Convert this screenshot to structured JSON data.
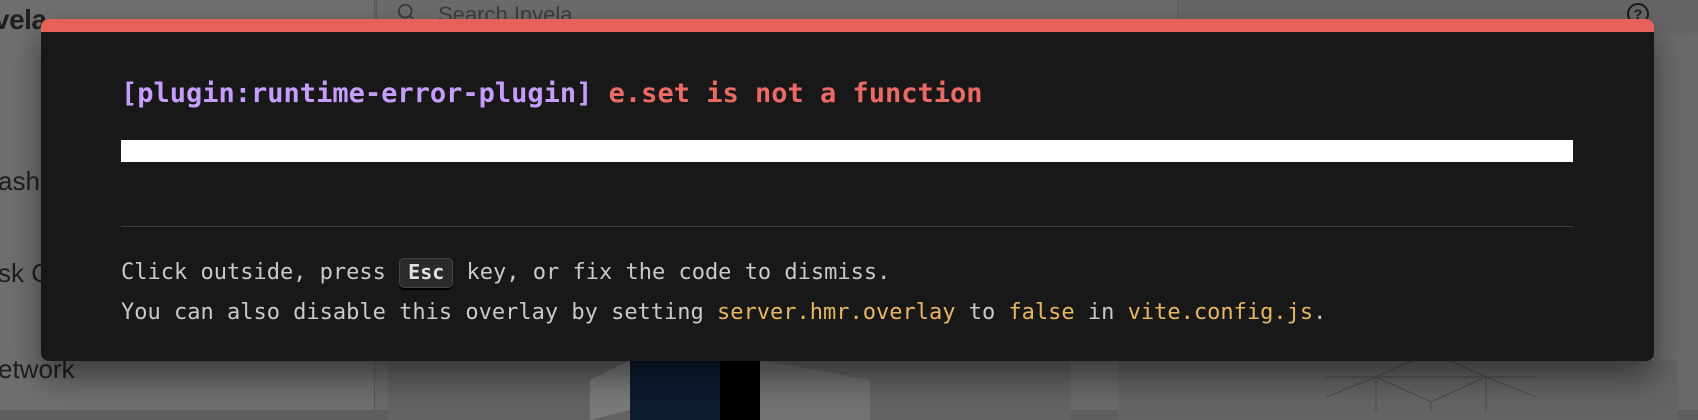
{
  "app": {
    "logo_text": "vela",
    "search_placeholder": "Search Invela",
    "nav_items": [
      {
        "label": "ashb"
      },
      {
        "label": "sk C"
      },
      {
        "label": "etwork"
      }
    ]
  },
  "overlay": {
    "plugin_tag": "[plugin:runtime-error-plugin]",
    "message": "e.set is not a function",
    "tip_line1": {
      "before": "Click outside, press ",
      "key": "Esc",
      "after": " key, or fix the code to dismiss."
    },
    "tip_line2": {
      "part1": "You can also disable this overlay by setting ",
      "code1": "server.hmr.overlay",
      "part2": " to ",
      "code2": "false",
      "part3": " in ",
      "code3": "vite.config.js",
      "part4": "."
    },
    "colors": {
      "accent_bar": "#e8605a",
      "plugin_tag": "#c79dfb",
      "message": "#ec6a65",
      "code_highlight": "#e8b65f",
      "background": "#181818"
    }
  },
  "icons": {
    "search": "search-icon",
    "help": "help-circle-icon"
  }
}
